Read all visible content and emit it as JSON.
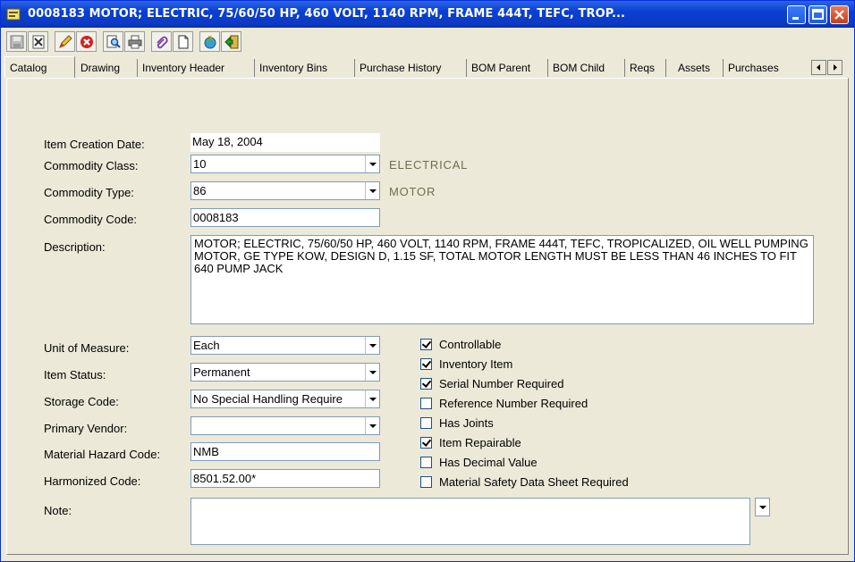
{
  "window": {
    "title": "0008183 MOTOR; ELECTRIC, 75/60/50 HP, 460 VOLT, 1140 RPM, FRAME 444T, TEFC, TROP..."
  },
  "toolbar": {
    "icons": [
      "save-icon",
      "cancel-edit-icon",
      "edit-icon",
      "delete-icon",
      "find-icon",
      "print-icon",
      "attach-icon",
      "new-icon",
      "refresh-icon",
      "exit-icon"
    ]
  },
  "tabs": [
    "Catalog",
    "Drawing",
    "Inventory Header",
    "Inventory Bins",
    "Purchase History",
    "BOM Parent",
    "BOM Child",
    "Reqs",
    "Assets",
    "Purchases"
  ],
  "form": {
    "item_creation_date_label": "Item Creation Date:",
    "item_creation_date": "May 18, 2004",
    "commodity_class_label": "Commodity Class:",
    "commodity_class": "10",
    "commodity_class_desc": "ELECTRICAL",
    "commodity_type_label": "Commodity Type:",
    "commodity_type": "86",
    "commodity_type_desc": "MOTOR",
    "commodity_code_label": "Commodity Code:",
    "commodity_code": "0008183",
    "description_label": "Description:",
    "description": "MOTOR; ELECTRIC, 75/60/50 HP, 460 VOLT, 1140 RPM, FRAME 444T, TEFC, TROPICALIZED, OIL WELL PUMPING MOTOR, GE TYPE KOW, DESIGN D, 1.15 SF, TOTAL MOTOR LENGTH MUST BE LESS THAN 46 INCHES TO FIT 640 PUMP JACK",
    "unit_of_measure_label": "Unit of Measure:",
    "unit_of_measure": "Each",
    "item_status_label": "Item Status:",
    "item_status": "Permanent",
    "storage_code_label": "Storage Code:",
    "storage_code": "No Special Handling Require",
    "primary_vendor_label": "Primary Vendor:",
    "primary_vendor": "",
    "material_hazard_code_label": "Material Hazard Code:",
    "material_hazard_code": "NMB",
    "harmonized_code_label": "Harmonized Code:",
    "harmonized_code": "8501.52.00*",
    "note_label": "Note:",
    "note": ""
  },
  "checkboxes": [
    {
      "label": "Controllable",
      "checked": true
    },
    {
      "label": "Inventory Item",
      "checked": true
    },
    {
      "label": "Serial Number Required",
      "checked": true
    },
    {
      "label": "Reference Number Required",
      "checked": false
    },
    {
      "label": "Has Joints",
      "checked": false
    },
    {
      "label": "Item Repairable",
      "checked": true
    },
    {
      "label": "Has Decimal Value",
      "checked": false
    },
    {
      "label": "Material Safety Data Sheet Required",
      "checked": false
    }
  ]
}
